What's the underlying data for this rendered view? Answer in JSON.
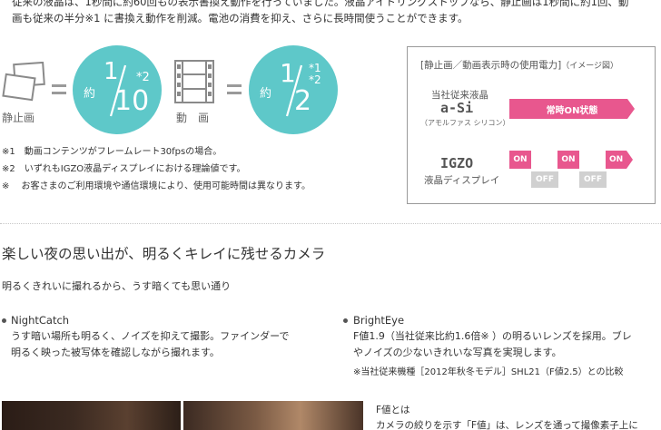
{
  "intro": {
    "line1": "従来の液晶は、1秒間に約60回もの表示書換え動作を行っていました。液晶アイドリングストップなら、静止画は1秒間に約1回、動",
    "line2": "画も従来の半分※1 に書換え動作を削減。電池の消費を抑え、さらに長時間使うことができます。"
  },
  "still_image": {
    "label": "静止画",
    "icon": "photo-icon",
    "circle": {
      "approx": "約",
      "numerator": "1",
      "denominator": "10",
      "note_mark": "*2"
    }
  },
  "video": {
    "label": "動　画",
    "icon": "film-icon",
    "circle": {
      "approx": "約",
      "numerator": "1",
      "denominator": "2",
      "note_mark_1": "*1",
      "note_mark_2": "*2"
    }
  },
  "notes": [
    "※1　動画コンテンツがフレームレート30fpsの場合。",
    "※2　いずれもIGZO液晶ディスプレイにおける理論値です。",
    "※　 お客さまのご利用環境や通信環境により、使用可能時間は異なります。"
  ],
  "power_panel": {
    "title": "[静止画／動画表示時の使用電力]",
    "title_suffix": "（イメージ図）",
    "asi": {
      "label_top": "当社従来液晶",
      "name": "a-Si",
      "sub": "（アモルファス シリコン）",
      "bar": "常時ON状態"
    },
    "igzo": {
      "name": "IGZO",
      "sub": "液晶ディスプレイ",
      "on1": "ON",
      "on2": "ON",
      "on3": "ON",
      "off1": "OFF",
      "off2": "OFF"
    },
    "colors": {
      "pink": "#e8578e",
      "gray": "#d0d0d0",
      "teal": "#5ec8c9"
    }
  },
  "camera": {
    "heading": "楽しい夜の思い出が、明るくキレイに残せるカメラ",
    "lead": "明るくきれいに撮れるから、うす暗くても思い通り",
    "features": [
      {
        "title": "NightCatch",
        "line1": "うす暗い場所も明るく、ノイズを抑えて撮影。ファインダーで",
        "line2": "明るく映った被写体を確認しながら撮れます。"
      },
      {
        "title": "BrightEye",
        "line1": "F値1.9（当社従来比約1.6倍※ ）の明るいレンズを採用。ブレ",
        "line2": "やノイズの少ないきれいな写真を実現します。",
        "note": "※当社従来機種［2012年秋冬モデル］SHL21（F値2.5）との比較"
      }
    ],
    "fvalue": {
      "title": "F値とは",
      "text": "カメラの絞りを示す「F値」は、レンズを通って撮像素子上に"
    }
  }
}
